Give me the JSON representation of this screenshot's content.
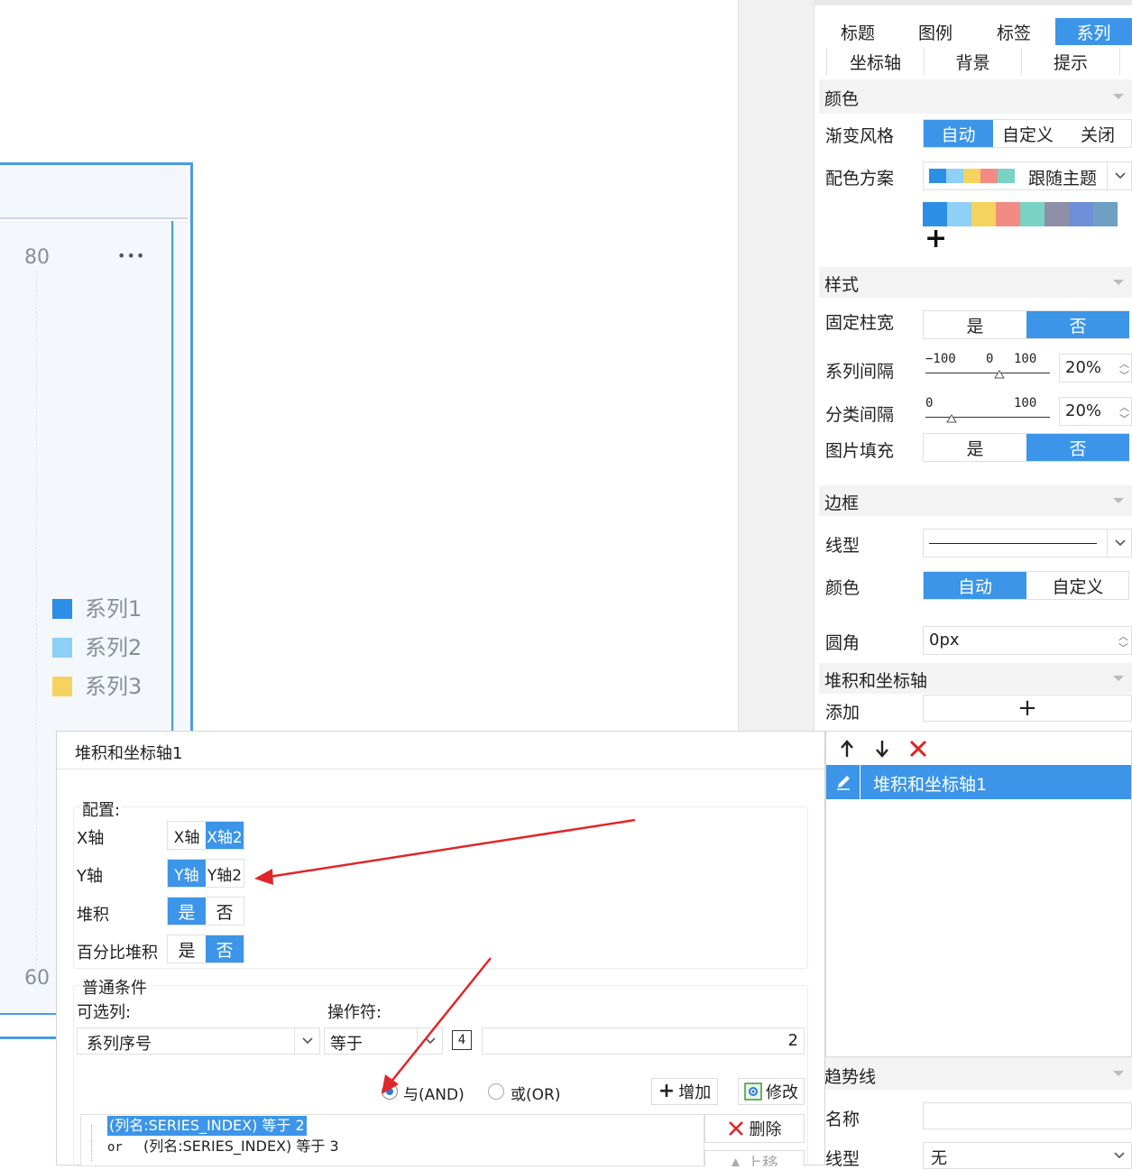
{
  "chart": {
    "y_top_tick": "80",
    "y_bottom_tick": "60",
    "more": "•••",
    "legend": [
      {
        "label": "系列1",
        "color": "#2d8ee6"
      },
      {
        "label": "系列2",
        "color": "#8fd0f6"
      },
      {
        "label": "系列3",
        "color": "#f6d35e"
      }
    ]
  },
  "panel": {
    "tabs_row1": [
      "标题",
      "图例",
      "标签",
      "系列"
    ],
    "tabs_row2": [
      "坐标轴",
      "背景",
      "提示"
    ],
    "active_tab": "系列",
    "section_color": "颜色",
    "gradient_label": "渐变风格",
    "gradient_options": [
      "自动",
      "自定义",
      "关闭"
    ],
    "scheme_label": "配色方案",
    "scheme_value": "跟随主题",
    "scheme_swatches": [
      "#2d8ee6",
      "#8fd0f6",
      "#f6d35e",
      "#f28b82",
      "#79d3c5",
      "#8e8fa8",
      "#6f8fd9",
      "#6ea0c4"
    ],
    "plus": "+",
    "section_style": "样式",
    "fixed_width_label": "固定柱宽",
    "yes": "是",
    "no": "否",
    "series_gap_label": "系列间隔",
    "series_gap_ticks": [
      "−100",
      "0",
      "100"
    ],
    "series_gap_value": "20%",
    "category_gap_label": "分类间隔",
    "category_gap_ticks": [
      "0",
      "100"
    ],
    "category_gap_value": "20%",
    "image_fill_label": "图片填充",
    "section_border": "边框",
    "line_type_label": "线型",
    "border_color_label": "颜色",
    "border_color_options": [
      "自动",
      "自定义"
    ],
    "radius_label": "圆角",
    "radius_value": "0px",
    "section_stack": "堆积和坐标轴",
    "add_label": "添加",
    "stack_list": [
      "堆积和坐标轴1"
    ],
    "section_trend": "趋势线",
    "name_label": "名称",
    "trend_line_label": "线型",
    "trend_line_value": "无"
  },
  "dialog": {
    "title": "堆积和坐标轴1",
    "config_legend": "配置:",
    "x_axis_label": "X轴",
    "x_axis_options": [
      "X轴",
      "X轴2"
    ],
    "y_axis_label": "Y轴",
    "y_axis_options": [
      "Y轴",
      "Y轴2"
    ],
    "stack_label": "堆积",
    "stack_options": [
      "是",
      "否"
    ],
    "percent_label": "百分比堆积",
    "percent_options": [
      "是",
      "否"
    ],
    "cond_legend": "普通条件",
    "column_label": "可选列:",
    "column_value": "系列序号",
    "operator_label": "操作符:",
    "operator_value": "等于",
    "param_icon": "4",
    "value": "2",
    "and_label": "与(AND)",
    "or_label": "或(OR)",
    "add_btn": "增加",
    "modify_btn": "修改",
    "delete_btn": "删除",
    "up_btn": "上移",
    "conditions": [
      {
        "prefix": "",
        "text": "(列名:SERIES_INDEX) 等于 2"
      },
      {
        "prefix": "or",
        "text": "(列名:SERIES_INDEX) 等于 3"
      }
    ]
  }
}
